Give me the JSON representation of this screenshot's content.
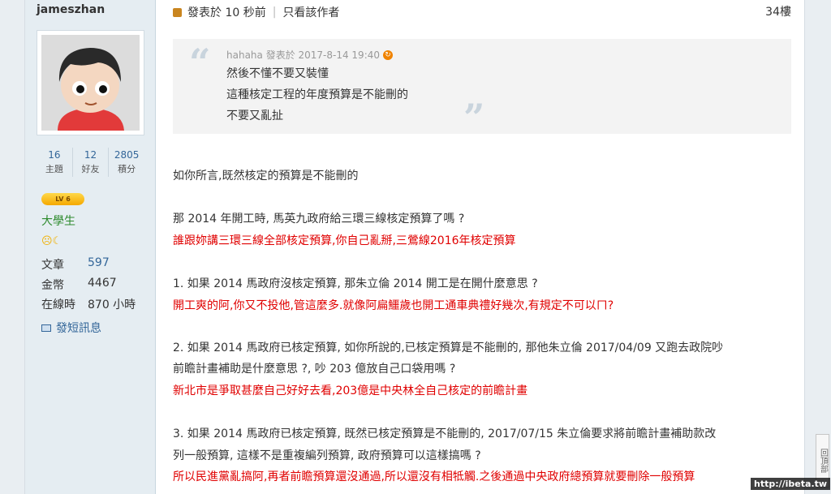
{
  "sidebar": {
    "username": "jameszhan",
    "stats": [
      {
        "num": "16",
        "label": "主題"
      },
      {
        "num": "12",
        "label": "好友"
      },
      {
        "num": "2805",
        "label": "積分"
      }
    ],
    "level_badge": "LV 6",
    "rank": "大學生",
    "info": [
      {
        "key": "文章",
        "value": "597"
      },
      {
        "key": "金幣",
        "value": "4467"
      },
      {
        "key": "在線時",
        "value": "870 小時"
      }
    ],
    "pm_label": "發短訊息"
  },
  "post": {
    "meta": "發表於 10 秒前",
    "author_only": "只看該作者",
    "floor": "34樓",
    "quote": {
      "header": "hahaha 發表於 2017-8-14 19:40",
      "lines": [
        "然後不懂不要又裝懂",
        "這種核定工程的年度預算是不能刪的",
        "不要又亂扯"
      ]
    },
    "lines": [
      {
        "text": "如你所言,既然核定的預算是不能刪的",
        "red": false
      },
      {
        "text": "那 2014 年開工時, 馬英九政府給三環三線核定預算了嗎 ?",
        "red": false
      },
      {
        "text": "誰跟妳講三環三線全部核定預算,你自己亂掰,三鶯線2016年核定預算",
        "red": true
      },
      {
        "text": "1. 如果 2014 馬政府沒核定預算, 那朱立倫 2014 開工是在開什麼意思 ?",
        "red": false
      },
      {
        "text": "開工爽的阿,你又不投他,管這麼多.就像阿扁鱷歲也開工通車典禮好幾次,有規定不可以ㄇ?",
        "red": true
      },
      {
        "text": "2. 如果 2014 馬政府已核定預算, 如你所說的,已核定預算是不能刪的, 那他朱立倫 2017/04/09 又跑去政院吵",
        "red": false
      },
      {
        "text": "前瞻計畫補助是什麼意思 ?, 吵 203 億放自己口袋用嗎 ?",
        "red": false
      },
      {
        "text": "新北市是爭取甚麼自己好好去看,203億是中央林全自己核定的前瞻計畫",
        "red": true
      },
      {
        "text": "3. 如果 2014 馬政府已核定預算,  既然已核定預算是不能刪的,  2017/07/15 朱立倫要求將前瞻計畫補助款改",
        "red": false
      },
      {
        "text": "列一般預算, 這樣不是重複編列預算, 政府預算可以這樣搞嗎 ?",
        "red": false
      },
      {
        "text": "所以民進黨亂搞阿,再者前瞻預算還沒通過,所以還沒有相牴觸.之後通過中央政府總預算就要刪除一般預算",
        "red": true
      }
    ]
  },
  "back_to_top": "回頂部",
  "watermark": "http://ibeta.tw"
}
